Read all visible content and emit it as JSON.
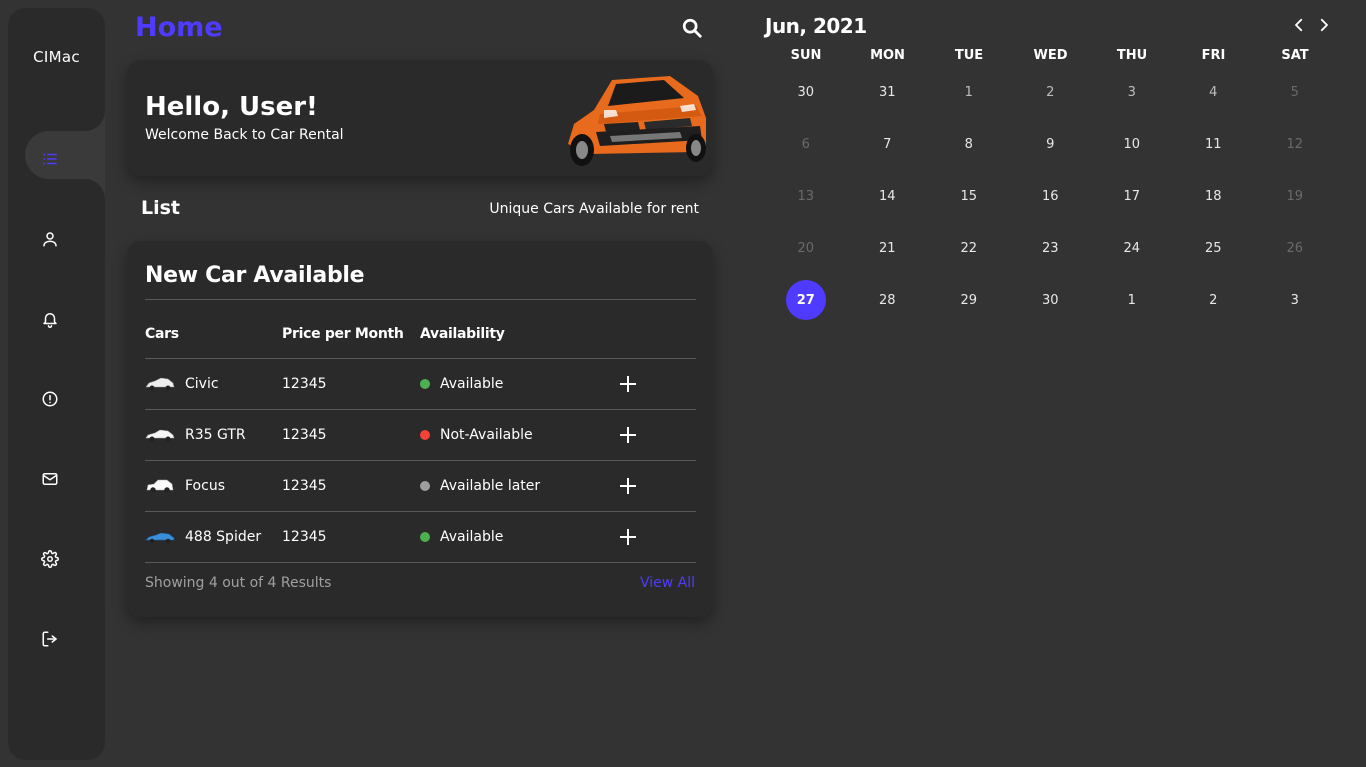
{
  "app": {
    "logo": "CIMac"
  },
  "header": {
    "title": "Home"
  },
  "sidebar": {
    "items": [
      {
        "name": "list",
        "icon": "list-icon"
      },
      {
        "name": "profile",
        "icon": "user-icon"
      },
      {
        "name": "notifications",
        "icon": "bell-icon"
      },
      {
        "name": "alerts",
        "icon": "alert-circle-icon"
      },
      {
        "name": "messages",
        "icon": "mail-icon"
      },
      {
        "name": "settings",
        "icon": "gear-icon"
      },
      {
        "name": "logout",
        "icon": "logout-icon"
      }
    ],
    "active": "list"
  },
  "hero": {
    "title": "Hello, User!",
    "subtitle": "Welcome Back to Car Rental"
  },
  "list": {
    "title": "List",
    "subtitle": "Unique Cars Available for rent"
  },
  "table": {
    "title": "New Car Available",
    "columns": [
      "Cars",
      "Price per Month",
      "Availability"
    ],
    "rows": [
      {
        "car": "Civic",
        "price": "12345",
        "status": "Available",
        "status_color": "#4caf50"
      },
      {
        "car": "R35 GTR",
        "price": "12345",
        "status": "Not-Available",
        "status_color": "#f44336"
      },
      {
        "car": "Focus",
        "price": "12345",
        "status": "Available later",
        "status_color": "#9e9e9e"
      },
      {
        "car": "488 Spider",
        "price": "12345",
        "status": "Available",
        "status_color": "#4caf50"
      }
    ],
    "footer": "Showing 4 out of 4 Results",
    "view_all": "View All"
  },
  "calendar": {
    "title": "Jun, 2021",
    "weekdays": [
      "SUN",
      "MON",
      "TUE",
      "WED",
      "THU",
      "FRI",
      "SAT"
    ],
    "weeks": [
      [
        "30",
        "31",
        "1",
        "2",
        "3",
        "4",
        "5"
      ],
      [
        "6",
        "7",
        "8",
        "9",
        "10",
        "11",
        "12"
      ],
      [
        "13",
        "14",
        "15",
        "16",
        "17",
        "18",
        "19"
      ],
      [
        "20",
        "21",
        "22",
        "23",
        "24",
        "25",
        "26"
      ],
      [
        "27",
        "28",
        "29",
        "30",
        "1",
        "2",
        "3"
      ]
    ],
    "selected": "27"
  },
  "colors": {
    "accent": "#4f3bff",
    "background": "#333333",
    "card": "#2a2a2a"
  }
}
